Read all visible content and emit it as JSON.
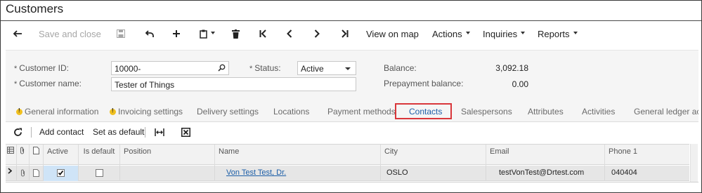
{
  "window": {
    "title": "Customers"
  },
  "toolbar": {
    "save_close_label": "Save and close",
    "view_on_map_label": "View on map",
    "actions_label": "Actions",
    "inquiries_label": "Inquiries",
    "reports_label": "Reports",
    "icons": [
      "back-arrow-icon",
      "save-icon",
      "undo-icon",
      "plus-icon",
      "clipboard-icon",
      "trash-icon",
      "first-page-icon",
      "previous-icon",
      "next-icon",
      "last-page-icon"
    ]
  },
  "form": {
    "customer_id": {
      "label": "Customer ID:",
      "value": "10000-"
    },
    "customer_name": {
      "label": "Customer name:",
      "value": "Tester of Things"
    },
    "status": {
      "label": "Status:",
      "value": "Active"
    },
    "balance": {
      "label": "Balance:",
      "value": "3,092.18"
    },
    "prepayment_balance": {
      "label": "Prepayment balance:",
      "value": "0.00"
    },
    "required_marker": "*"
  },
  "tabs": [
    {
      "label": "General information",
      "warning": true
    },
    {
      "label": "Invoicing settings",
      "warning": true
    },
    {
      "label": "Delivery settings",
      "warning": false
    },
    {
      "label": "Locations",
      "warning": false
    },
    {
      "label": "Payment methods",
      "warning": false
    },
    {
      "label": "Contacts",
      "warning": false,
      "active": true
    },
    {
      "label": "Salespersons",
      "warning": false
    },
    {
      "label": "Attributes",
      "warning": false
    },
    {
      "label": "Activities",
      "warning": false
    },
    {
      "label": "General ledger accou",
      "warning": false
    }
  ],
  "grid_toolbar": {
    "add_contact_label": "Add contact",
    "set_default_label": "Set as default"
  },
  "grid": {
    "columns": [
      "Active",
      "Is default",
      "Position",
      "Name",
      "City",
      "Email",
      "Phone 1"
    ],
    "rows": [
      {
        "active": true,
        "is_default": false,
        "position": "",
        "name": "Von Test Test, Dr.",
        "city": "OSLO",
        "email": "testVonTest@Drtest.com",
        "phone1": "040404"
      }
    ]
  },
  "colors": {
    "accent": "#1d5fa8",
    "highlight_border": "#d9373b",
    "warning": "#f0c020"
  }
}
